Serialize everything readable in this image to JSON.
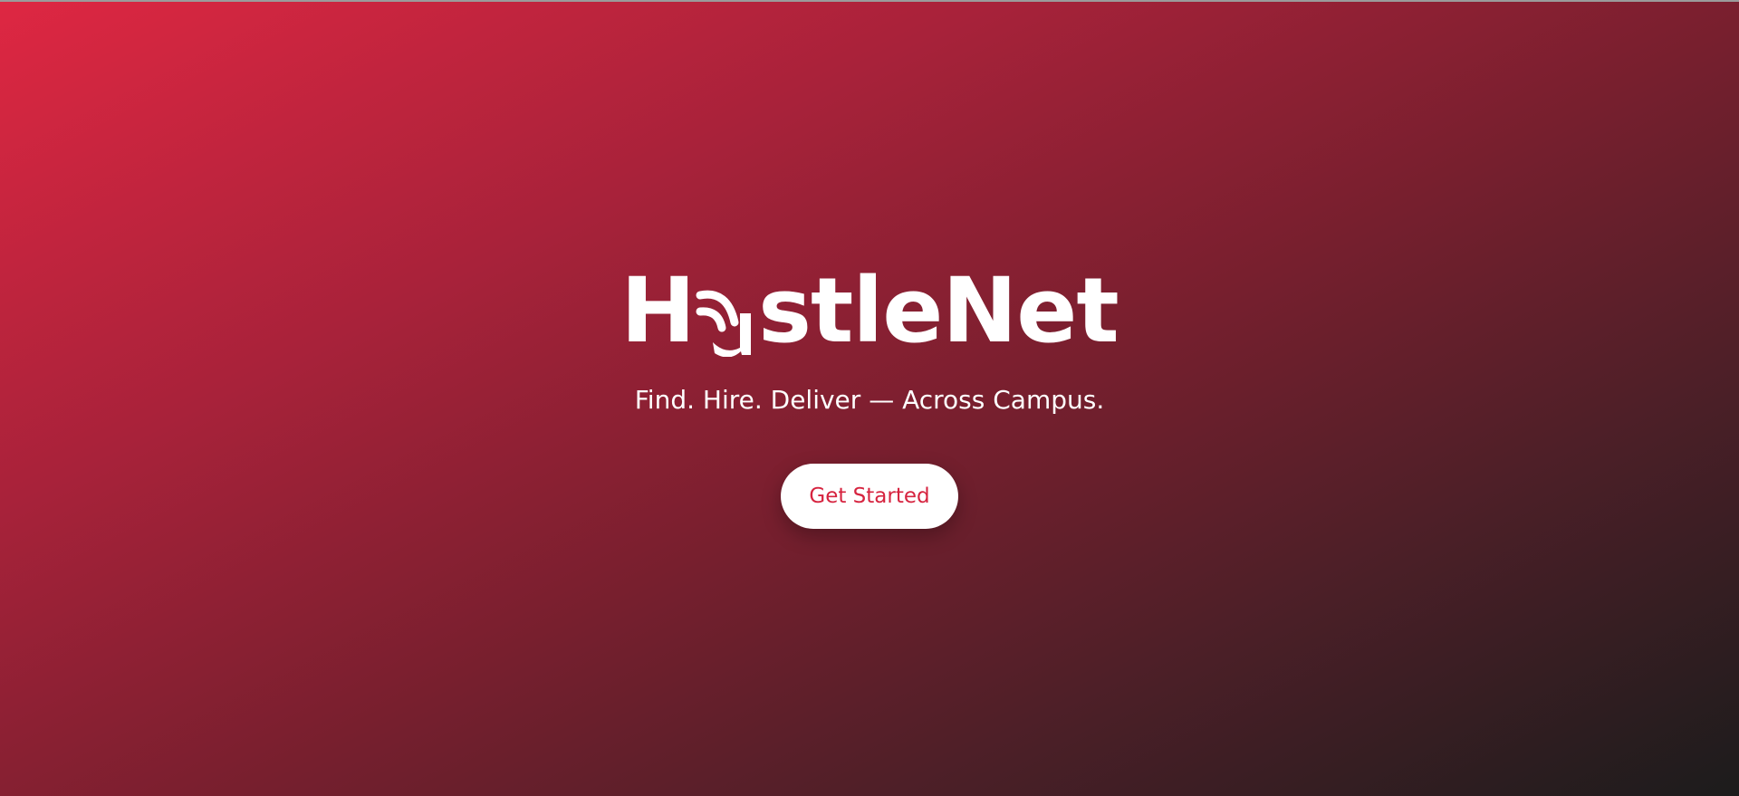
{
  "brand": {
    "logo_prefix": "H",
    "logo_suffix": "stleNet",
    "logo_text": "HustleNet",
    "logo_icon": "wifi-signal-u-icon",
    "tagline": "Find. Hire. Deliver — Across Campus."
  },
  "cta": {
    "label": "Get Started"
  },
  "colors": {
    "gradient_start": "#de2742",
    "gradient_end": "#1c1c1c",
    "accent": "#d6233f",
    "text": "#ffffff"
  }
}
